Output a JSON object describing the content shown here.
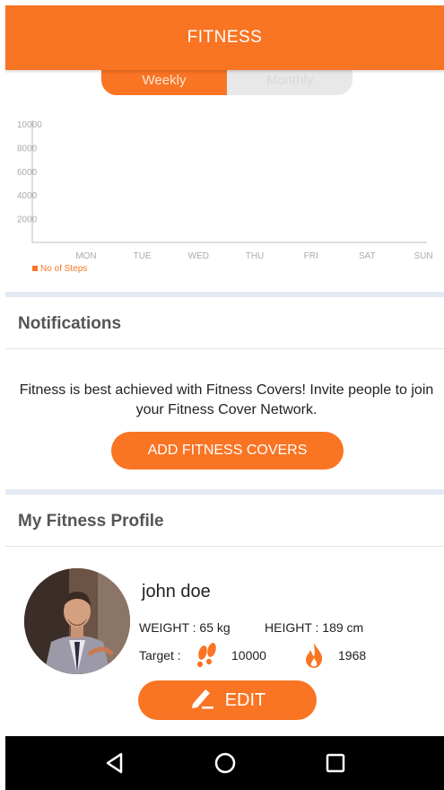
{
  "header": {
    "title": "FITNESS"
  },
  "toggle": {
    "weekly_label": "Weekly",
    "monthly_label": "Monthly"
  },
  "chart_data": {
    "type": "bar",
    "categories": [
      "MON",
      "TUE",
      "WED",
      "THU",
      "FRI",
      "SAT",
      "SUN"
    ],
    "y_ticks": [
      "10000",
      "8000",
      "6000",
      "4000",
      "2000"
    ],
    "series": [
      {
        "name": "No of Steps",
        "values": [
          0,
          0,
          0,
          0,
          0,
          0,
          0
        ]
      }
    ],
    "ylim": [
      0,
      10000
    ],
    "grid": false,
    "legend_position": "bottom-left",
    "colors": {
      "series": "#f97423",
      "axis": "#bdbdbd",
      "tick_text": "#aaaaaa"
    }
  },
  "notifications": {
    "title": "Notifications",
    "message": "Fitness is best achieved with Fitness Covers! Invite people to join your Fitness Cover Network.",
    "button_label": "ADD FITNESS COVERS"
  },
  "profile": {
    "title": "My Fitness Profile",
    "name": "john doe",
    "weight_text": "WEIGHT : 65 kg",
    "height_text": "HEIGHT : 189 cm",
    "target_label": "Target :",
    "steps_target": "10000",
    "calories_target": "1968",
    "edit_label": "EDIT"
  },
  "icons": {
    "steps": "footprints-icon",
    "calories": "flame-icon",
    "edit": "pencil-icon"
  },
  "navbar": {
    "back": "back-icon",
    "home": "home-icon",
    "recents": "recents-icon"
  },
  "colors": {
    "accent": "#f97423",
    "separator": "#e4eaf3"
  }
}
